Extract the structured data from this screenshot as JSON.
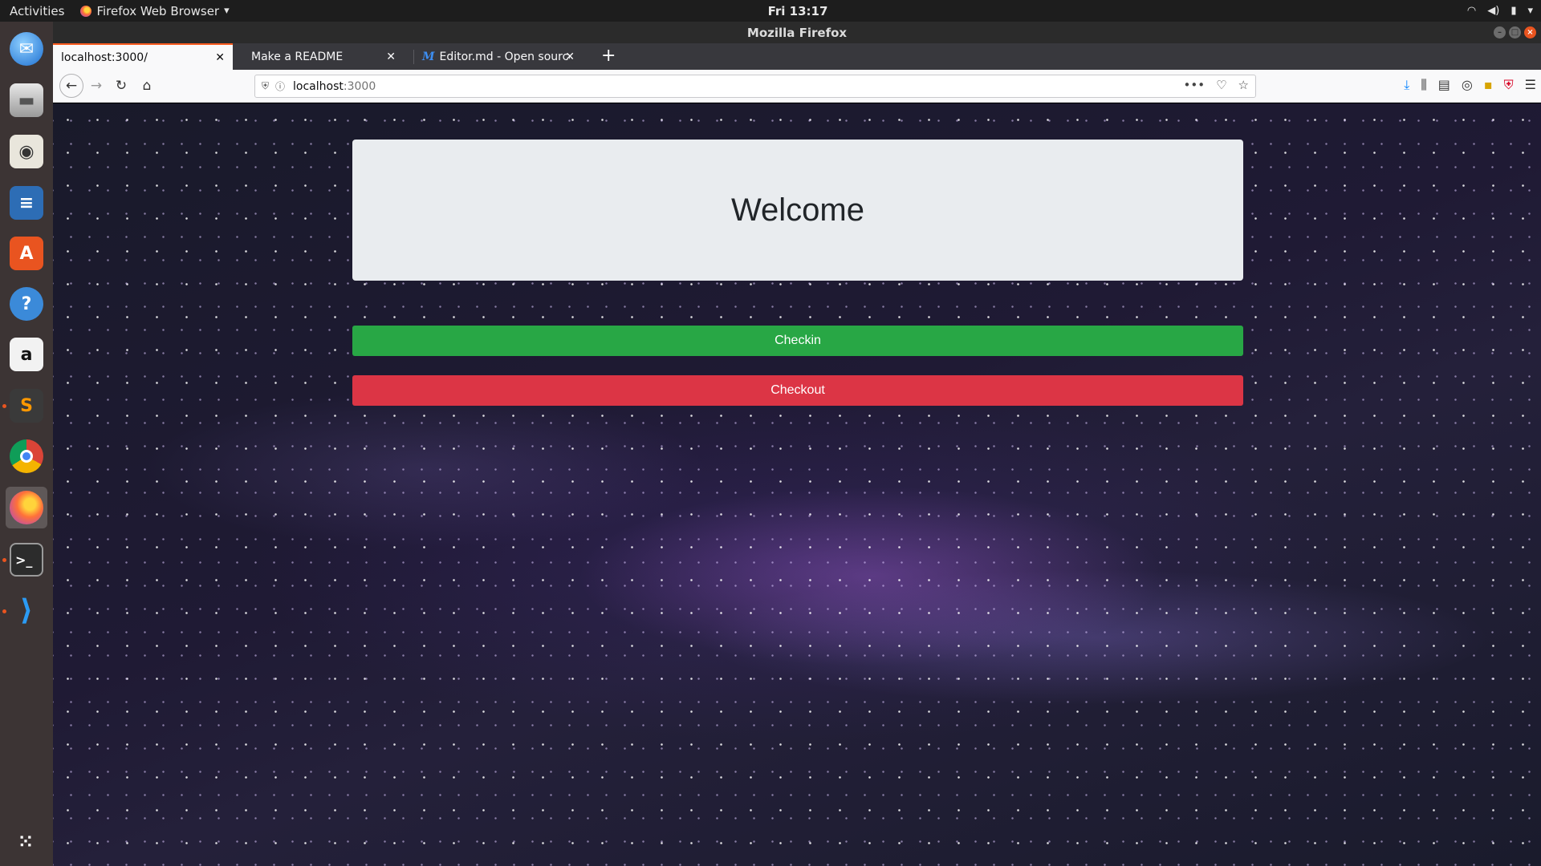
{
  "topbar": {
    "activities": "Activities",
    "app_menu": "Firefox Web Browser",
    "clock": "Fri 13:17"
  },
  "window": {
    "title": "Mozilla Firefox"
  },
  "tabs": [
    {
      "label": "localhost:3000/",
      "active": true
    },
    {
      "label": "Make a README",
      "active": false
    },
    {
      "label": "Editor.md - Open source",
      "active": false
    }
  ],
  "navbar": {
    "url_host": "localhost",
    "url_port": ":3000"
  },
  "page": {
    "heading": "Welcome",
    "checkin_label": "Checkin",
    "checkout_label": "Checkout"
  },
  "colors": {
    "success": "#28a745",
    "danger": "#dc3545",
    "jumbotron": "#e9ecef",
    "tab_accent": "#ff5b1f"
  },
  "dock": [
    {
      "icon": "thunderbird-icon"
    },
    {
      "icon": "files-icon"
    },
    {
      "icon": "rhythmbox-icon"
    },
    {
      "icon": "libreoffice-writer-icon"
    },
    {
      "icon": "ubuntu-software-icon"
    },
    {
      "icon": "help-icon"
    },
    {
      "icon": "amazon-icon"
    },
    {
      "icon": "sublime-text-icon"
    },
    {
      "icon": "chrome-icon"
    },
    {
      "icon": "firefox-icon"
    },
    {
      "icon": "terminal-icon"
    },
    {
      "icon": "vscode-icon"
    },
    {
      "icon": "show-apps-icon"
    }
  ]
}
